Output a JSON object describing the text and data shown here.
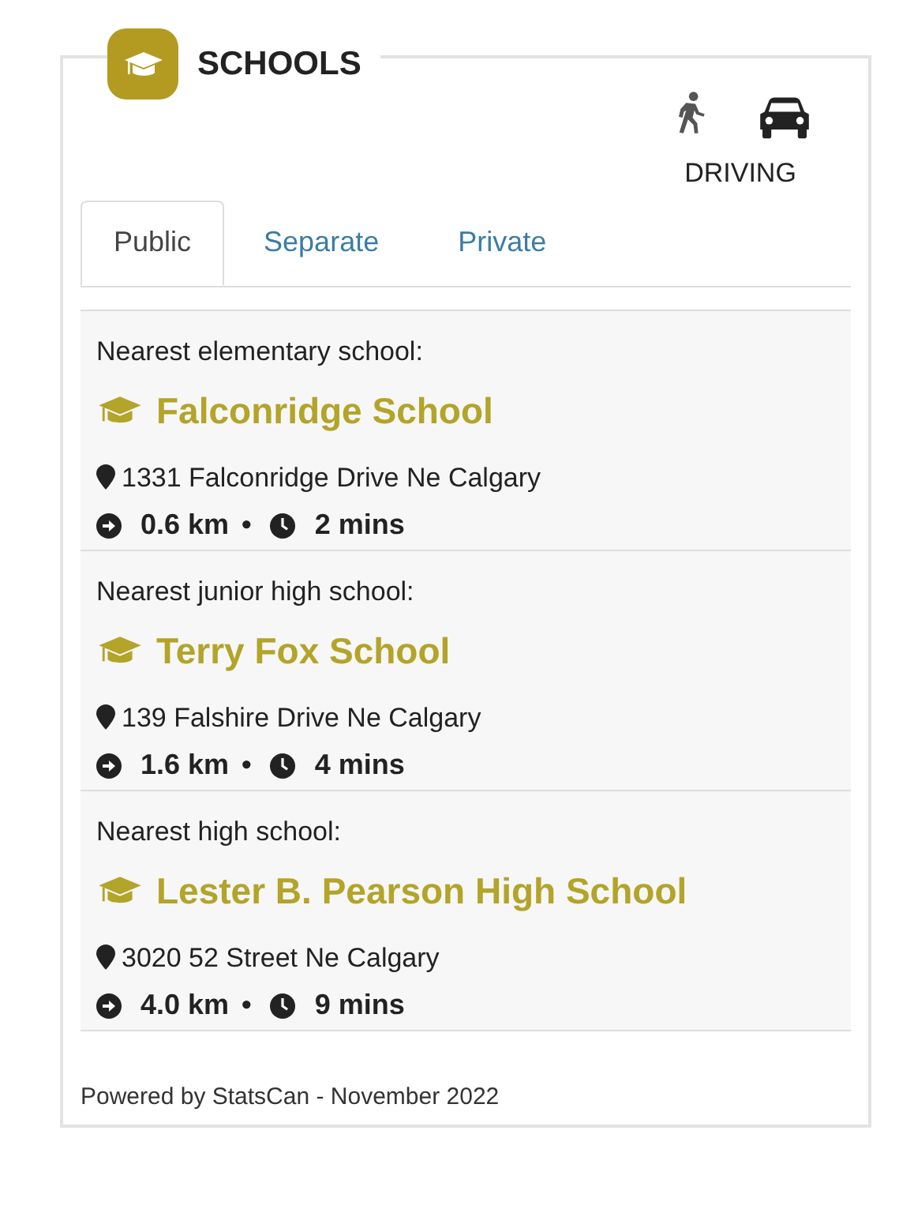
{
  "title": "SCHOOLS",
  "modes": [
    {
      "kind": "walking",
      "selected": false
    },
    {
      "kind": "driving",
      "selected": true
    }
  ],
  "mode_label": "DRIVING",
  "tabs": [
    {
      "label": "Public",
      "selected": true
    },
    {
      "label": "Separate",
      "selected": false
    },
    {
      "label": "Private",
      "selected": false
    }
  ],
  "schools": [
    {
      "level": "Nearest elementary school:",
      "name": "Falconridge School",
      "address": "1331 Falconridge Drive Ne Calgary",
      "distance": "0.6 km",
      "separator": "•",
      "time": "2 mins"
    },
    {
      "level": "Nearest junior high school:",
      "name": "Terry Fox School",
      "address": "139 Falshire Drive Ne Calgary",
      "distance": "1.6 km",
      "separator": "•",
      "time": "4 mins"
    },
    {
      "level": "Nearest high school:",
      "name": "Lester B. Pearson High School",
      "address": "3020 52 Street Ne Calgary",
      "distance": "4.0 km",
      "separator": "•",
      "time": "9 mins"
    }
  ],
  "footer": "Powered by StatsCan - November 2022"
}
